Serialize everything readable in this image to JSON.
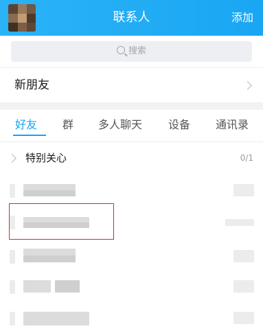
{
  "header": {
    "title": "联系人",
    "add_label": "添加"
  },
  "search": {
    "placeholder": "搜索"
  },
  "new_friends": {
    "label": "新朋友"
  },
  "tabs": [
    {
      "label": "好友",
      "active": true
    },
    {
      "label": "群",
      "active": false
    },
    {
      "label": "多人聊天",
      "active": false
    },
    {
      "label": "设备",
      "active": false
    },
    {
      "label": "通讯录",
      "active": false
    }
  ],
  "group": {
    "label": "特别关心",
    "count": "0/1"
  },
  "colors": {
    "header": "#1aa6f3",
    "accent": "#12a4f1",
    "highlight": "#d02a2a"
  }
}
